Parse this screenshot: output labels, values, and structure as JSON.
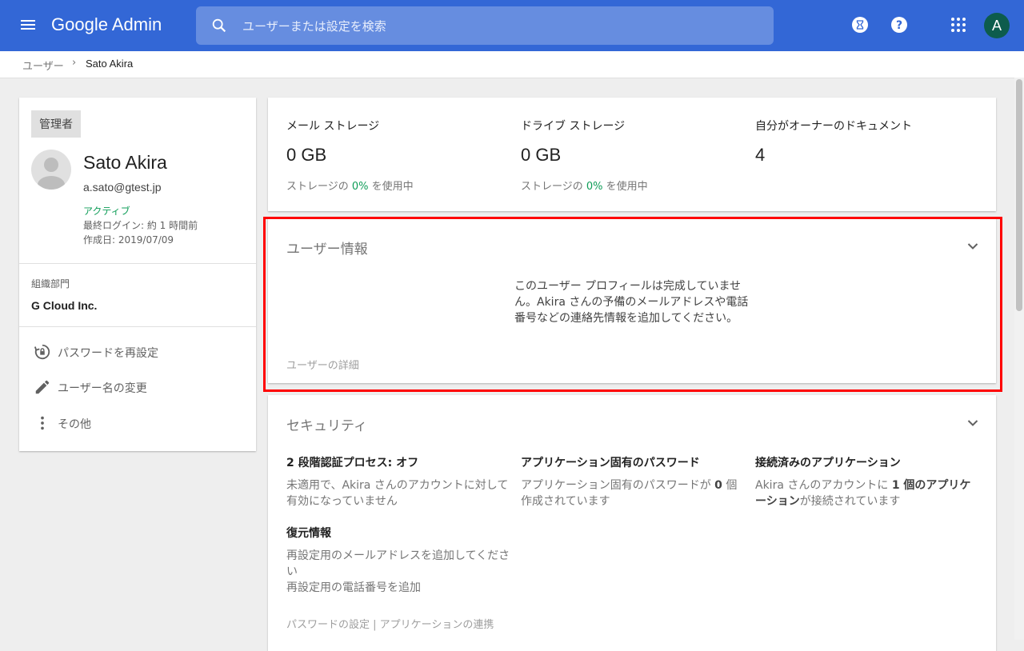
{
  "topbar": {
    "brand": "Google Admin",
    "search_placeholder": "ユーザーまたは設定を検索",
    "avatar_letter": "A",
    "accent_color": "#3367d6"
  },
  "breadcrumb": {
    "parent": "ユーザー",
    "current": "Sato Akira"
  },
  "profile": {
    "role": "管理者",
    "name": "Sato Akira",
    "email": "a.sato@gtest.jp",
    "status": "アクティブ",
    "last_login": "最終ログイン: 約 1 時間前",
    "created": "作成日: 2019/07/09",
    "org_label": "組織部門",
    "org_value": "G Cloud Inc.",
    "actions": [
      {
        "label": "パスワードを再設定",
        "icon": "lock-reset-icon"
      },
      {
        "label": "ユーザー名の変更",
        "icon": "pencil-icon"
      },
      {
        "label": "その他",
        "icon": "more-vert-icon"
      }
    ]
  },
  "storage": [
    {
      "title": "メール ストレージ",
      "value": "0 GB",
      "usage_prefix": "ストレージの ",
      "usage_pct": "0%",
      "usage_suffix": " を使用中"
    },
    {
      "title": "ドライブ ストレージ",
      "value": "0 GB",
      "usage_prefix": "ストレージの ",
      "usage_pct": "0%",
      "usage_suffix": " を使用中"
    },
    {
      "title": "自分がオーナーのドキュメント",
      "value": "4"
    }
  ],
  "user_info": {
    "title": "ユーザー情報",
    "message": "このユーザー プロフィールは完成していません。Akira さんの予備のメールアドレスや電話番号などの連絡先情報を追加してください。",
    "details_link": "ユーザーの詳細"
  },
  "security": {
    "title": "セキュリティ",
    "two_step_title": "2 段階認証プロセス: オフ",
    "two_step_body": "未適用で、Akira さんのアカウントに対して有効になっていません",
    "app_pw_title": "アプリケーション固有のパスワード",
    "app_pw_body": "アプリケーション固有のパスワードが ",
    "app_pw_count": "0",
    "app_pw_suffix": " 個作成されています",
    "connected_title": "接続済みのアプリケーション",
    "connected_prefix": "Akira さんのアカウントに ",
    "connected_bold": "1 個のアプリケーション",
    "connected_suffix": "が接続されています",
    "recovery_title": "復元情報",
    "recovery_email": "再設定用のメールアドレスを追加してください",
    "recovery_phone": "再設定用の電話番号を追加",
    "link_password": "パスワードの設定",
    "link_sep": " | ",
    "link_apps": "アプリケーションの連携"
  }
}
